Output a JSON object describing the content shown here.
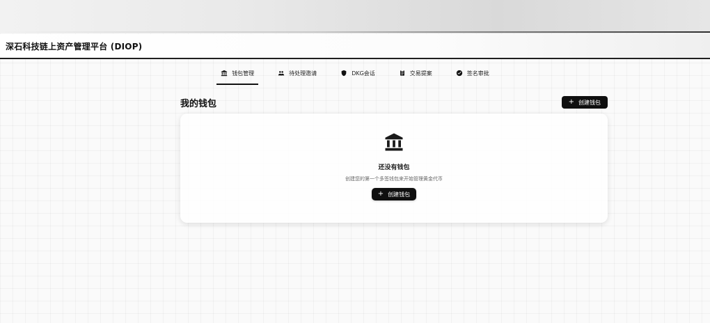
{
  "header": {
    "title": "深石科技链上资产管理平台 (DIOP)"
  },
  "nav": {
    "items": [
      {
        "label": "钱包管理",
        "icon": "bank-icon",
        "active": true
      },
      {
        "label": "待处理邀请",
        "icon": "users-icon",
        "active": false
      },
      {
        "label": "DKG会话",
        "icon": "shield-icon",
        "active": false
      },
      {
        "label": "交易提案",
        "icon": "clipboard-icon",
        "active": false
      },
      {
        "label": "签名审批",
        "icon": "check-circle-icon",
        "active": false
      }
    ]
  },
  "wallets": {
    "title": "我的钱包",
    "create_button": "创建钱包",
    "empty": {
      "icon": "bank-icon",
      "title": "还没有钱包",
      "description": "创建您的第一个多签钱包来开始管理黄金代币",
      "create_button": "创建钱包"
    }
  },
  "colors": {
    "primary": "#0f0f0f",
    "text": "#111111",
    "muted": "#666666",
    "card": "#ffffff"
  }
}
